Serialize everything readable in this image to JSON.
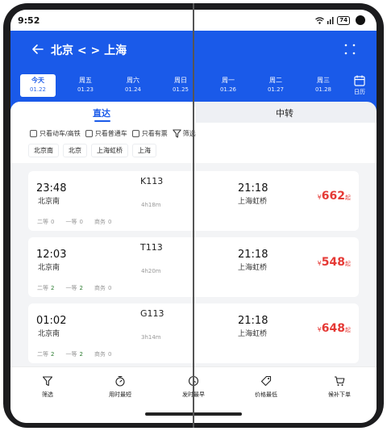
{
  "status_bar": {
    "time": "9:52",
    "battery": "74"
  },
  "header": {
    "title": "北京 < > 上海"
  },
  "dates": [
    {
      "day": "今天",
      "date": "01.22",
      "active": true
    },
    {
      "day": "周五",
      "date": "01.23"
    },
    {
      "day": "周六",
      "date": "01.24"
    },
    {
      "day": "周日",
      "date": "01.25"
    },
    {
      "day": "周一",
      "date": "01.26"
    },
    {
      "day": "周二",
      "date": "01.27"
    },
    {
      "day": "周三",
      "date": "01.28"
    }
  ],
  "calendar": {
    "label": "日历"
  },
  "tabs": {
    "direct": "直达",
    "transfer": "中转"
  },
  "filters": {
    "options": [
      "只看动车/高铁",
      "只看普通车",
      "只看有票"
    ],
    "filter_label": "筛选",
    "stations": [
      "北京南",
      "北京",
      "上海虹桥",
      "上海"
    ]
  },
  "trains": [
    {
      "dep_time": "23:48",
      "dep_station": "北京南",
      "train_no": "K113",
      "duration": "4h18m",
      "arr_time": "21:18",
      "arr_station": "上海虹桥",
      "currency": "¥",
      "price": "662",
      "price_suffix": "起",
      "seats": [
        {
          "name": "二等",
          "count": "0"
        },
        {
          "name": "一等",
          "count": "0"
        },
        {
          "name": "商务",
          "count": "0"
        }
      ]
    },
    {
      "dep_time": "12:03",
      "dep_station": "北京南",
      "train_no": "T113",
      "duration": "4h20m",
      "arr_time": "21:18",
      "arr_station": "上海虹桥",
      "currency": "¥",
      "price": "548",
      "price_suffix": "起",
      "seats": [
        {
          "name": "二等",
          "count": "2"
        },
        {
          "name": "一等",
          "count": "2"
        },
        {
          "name": "商务",
          "count": "0"
        }
      ]
    },
    {
      "dep_time": "01:02",
      "dep_station": "北京南",
      "train_no": "G113",
      "duration": "3h14m",
      "arr_time": "21:18",
      "arr_station": "上海虹桥",
      "currency": "¥",
      "price": "648",
      "price_suffix": "起",
      "seats": [
        {
          "name": "二等",
          "count": "2"
        },
        {
          "name": "一等",
          "count": "2"
        },
        {
          "name": "商务",
          "count": "0"
        }
      ]
    }
  ],
  "bottom_nav": [
    "筛选",
    "用时最短",
    "发时最早",
    "价格最低",
    "候补下单"
  ],
  "colors": {
    "brand": "#1a5ae9",
    "price": "#e53935",
    "seat_available": "#2e7d32"
  }
}
